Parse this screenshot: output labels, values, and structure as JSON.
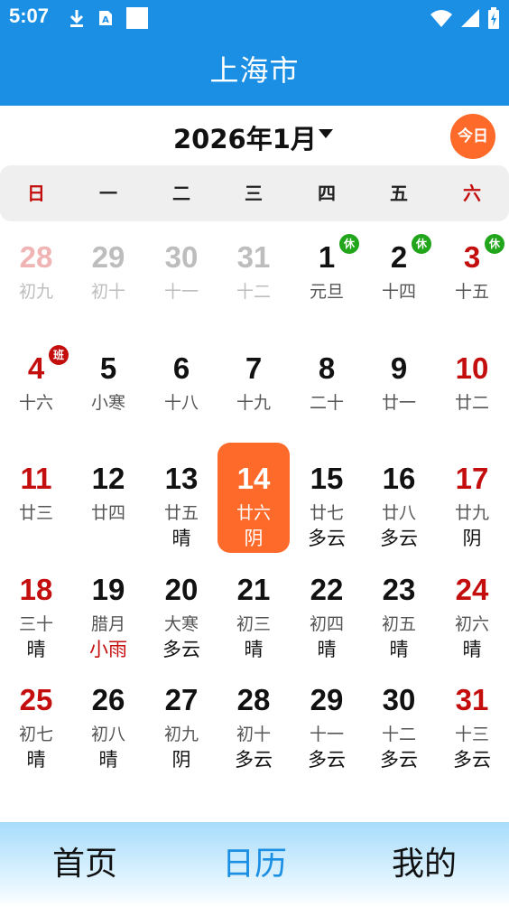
{
  "status_bar": {
    "time": "5:07",
    "left_icons": [
      "download-icon",
      "text-a-icon",
      "blank-square-icon"
    ],
    "right_icons": [
      "wifi-icon",
      "signal-icon",
      "battery-icon"
    ]
  },
  "header": {
    "title": "上海市"
  },
  "month_selector": {
    "label": "2026年1月",
    "today_label": "今日"
  },
  "weekdays": [
    "日",
    "一",
    "二",
    "三",
    "四",
    "五",
    "六"
  ],
  "colors": {
    "primary": "#1a8fe3",
    "accent": "#fd6a2a",
    "holiday_red": "#c40d0d",
    "rest_green": "#21a51b"
  },
  "calendar": {
    "selected_day": "14",
    "weeks": [
      [
        {
          "day": "28",
          "lunar": "初九",
          "other": true
        },
        {
          "day": "29",
          "lunar": "初十",
          "other": true
        },
        {
          "day": "30",
          "lunar": "十一",
          "other": true
        },
        {
          "day": "31",
          "lunar": "十二",
          "other": true
        },
        {
          "day": "1",
          "lunar": "元旦",
          "badge": "休"
        },
        {
          "day": "2",
          "lunar": "十四",
          "badge": "休"
        },
        {
          "day": "3",
          "lunar": "十五",
          "badge": "休"
        }
      ],
      [
        {
          "day": "4",
          "lunar": "十六",
          "badge": "班"
        },
        {
          "day": "5",
          "lunar": "小寒"
        },
        {
          "day": "6",
          "lunar": "十八"
        },
        {
          "day": "7",
          "lunar": "十九"
        },
        {
          "day": "8",
          "lunar": "二十"
        },
        {
          "day": "9",
          "lunar": "廿一"
        },
        {
          "day": "10",
          "lunar": "廿二"
        }
      ],
      [
        {
          "day": "11",
          "lunar": "廿三"
        },
        {
          "day": "12",
          "lunar": "廿四"
        },
        {
          "day": "13",
          "lunar": "廿五",
          "weather": "晴"
        },
        {
          "day": "14",
          "lunar": "廿六",
          "weather": "阴"
        },
        {
          "day": "15",
          "lunar": "廿七",
          "weather": "多云"
        },
        {
          "day": "16",
          "lunar": "廿八",
          "weather": "多云"
        },
        {
          "day": "17",
          "lunar": "廿九",
          "weather": "阴"
        }
      ],
      [
        {
          "day": "18",
          "lunar": "三十",
          "weather": "晴"
        },
        {
          "day": "19",
          "lunar": "腊月",
          "weather": "小雨"
        },
        {
          "day": "20",
          "lunar": "大寒",
          "weather": "多云"
        },
        {
          "day": "21",
          "lunar": "初三",
          "weather": "晴"
        },
        {
          "day": "22",
          "lunar": "初四",
          "weather": "晴"
        },
        {
          "day": "23",
          "lunar": "初五",
          "weather": "晴"
        },
        {
          "day": "24",
          "lunar": "初六",
          "weather": "晴"
        }
      ],
      [
        {
          "day": "25",
          "lunar": "初七",
          "weather": "晴"
        },
        {
          "day": "26",
          "lunar": "初八",
          "weather": "晴"
        },
        {
          "day": "27",
          "lunar": "初九",
          "weather": "阴"
        },
        {
          "day": "28",
          "lunar": "初十",
          "weather": "多云"
        },
        {
          "day": "29",
          "lunar": "十一",
          "weather": "多云"
        },
        {
          "day": "30",
          "lunar": "十二",
          "weather": "多云"
        },
        {
          "day": "31",
          "lunar": "十三",
          "weather": "多云"
        }
      ]
    ]
  },
  "bottom_nav": [
    {
      "label": "首页",
      "active": false
    },
    {
      "label": "日历",
      "active": true
    },
    {
      "label": "我的",
      "active": false
    }
  ]
}
